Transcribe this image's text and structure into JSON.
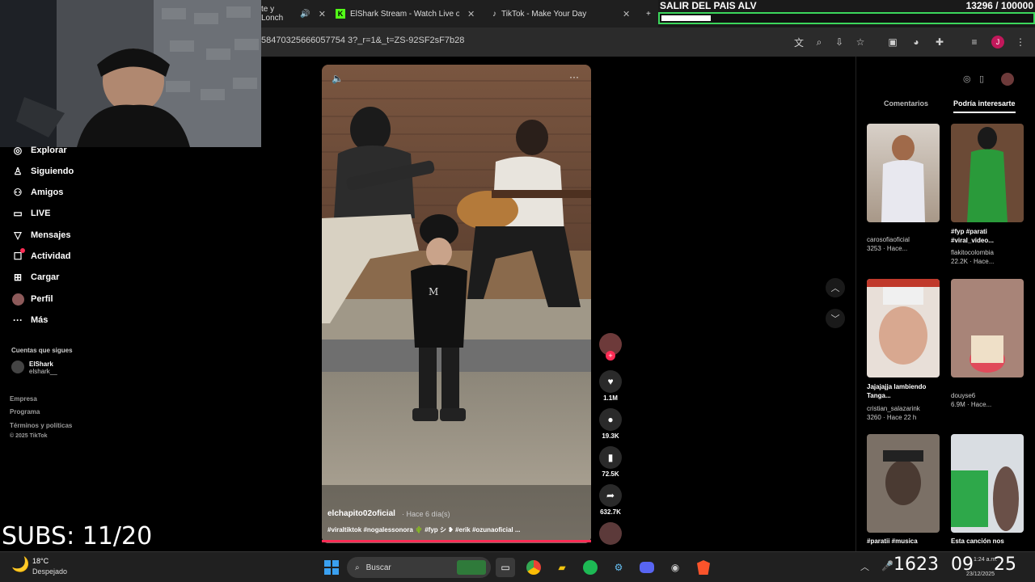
{
  "browser": {
    "tabs": [
      {
        "label": "te y Lonch"
      },
      {
        "label": "ElShark Stream - Watch Live on"
      },
      {
        "label": "TikTok - Make Your Day"
      }
    ],
    "url": "58470325666057754 3?_r=1&_t=ZS-92SF2sF7b28"
  },
  "overlay": {
    "goal_title": "SALIR DEL PAIS ALV",
    "goal_count": "13296  / 100000",
    "goal_progress": 0.133,
    "subs": "SUBS: 11/20"
  },
  "sidebar": {
    "items": [
      {
        "label": "Explorar",
        "icon": "compass-icon"
      },
      {
        "label": "Siguiendo",
        "icon": "user-icon"
      },
      {
        "label": "Amigos",
        "icon": "friends-icon"
      },
      {
        "label": "LIVE",
        "icon": "live-icon"
      },
      {
        "label": "Mensajes",
        "icon": "send-icon"
      },
      {
        "label": "Actividad",
        "icon": "activity-icon"
      },
      {
        "label": "Cargar",
        "icon": "plus-icon"
      },
      {
        "label": "Perfil",
        "icon": "avatar-icon"
      },
      {
        "label": "Más",
        "icon": "more-icon"
      }
    ],
    "following_title": "Cuentas que sigues",
    "account": {
      "name": "ElShark",
      "handle": "elshark__"
    },
    "footer": [
      "Empresa",
      "Programa",
      "Términos y políticas",
      "© 2025 TikTok"
    ]
  },
  "video": {
    "username": "elchapito02oficial",
    "time": "· Hace 6 día(s)",
    "tags": "#viraltiktok #nogalessonora 🌵 #fyp シ ❥ #erik #ozunaoficial ...",
    "likes": "1.1M",
    "comments": "19.3K",
    "saves": "72.5K",
    "shares": "632.7K"
  },
  "panel": {
    "tab_comments": "Comentarios",
    "tab_interesting": "Podría interesarte",
    "recs": [
      {
        "title": "",
        "user": "carosofiaoficial",
        "stat": "3253 · Hace..."
      },
      {
        "title": "#fyp #parati #viral_video...",
        "user": "flakitocolombia",
        "stat": "22.2K · Hace..."
      },
      {
        "title": "Jajajajja lambiendo Tanga...",
        "user": "cristian_salazarink",
        "stat": "3260 · Hace 22 h"
      },
      {
        "title": "",
        "user": "douyse6",
        "stat": "6.9M · Hace..."
      },
      {
        "title": "#paratii #musica",
        "user": "",
        "stat": ""
      },
      {
        "title": "Esta canción nos",
        "user": "",
        "stat": ""
      }
    ]
  },
  "taskbar": {
    "temp": "18°C",
    "weather": "Despejado",
    "search": "Buscar",
    "clock_a": "1623",
    "clock_b": "09",
    "clock_c": "25",
    "sys_time": "1:24 a.m.",
    "sys_date": "23/12/2025"
  },
  "colors": {
    "accent": "#fe2c55",
    "goal_border": "#3cd65c"
  }
}
